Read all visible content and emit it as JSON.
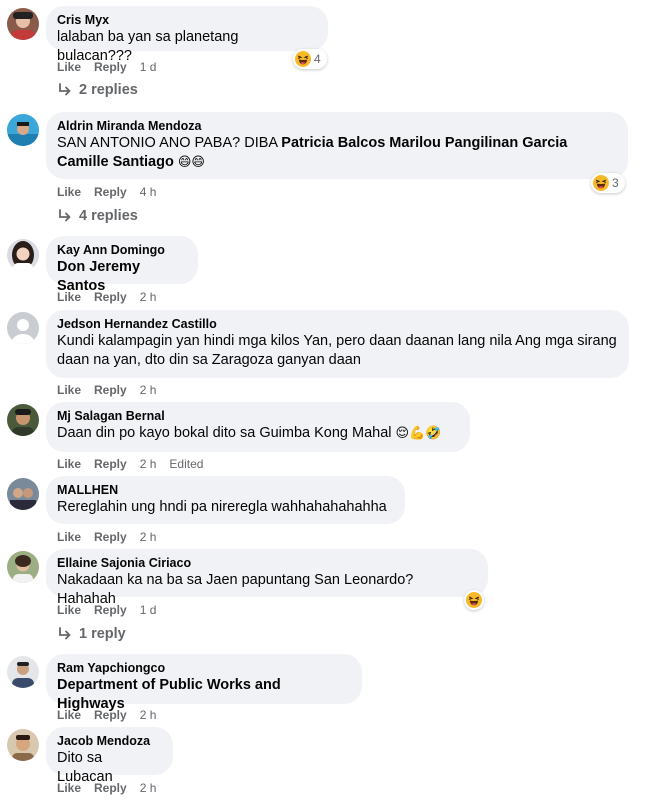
{
  "actions": {
    "like": "Like",
    "reply": "Reply"
  },
  "comments": [
    {
      "author": "Cris Myx",
      "text": "lalaban ba yan sa planetang bulacan???",
      "time": "1 d",
      "reactions": {
        "icon": "haha-emoji-icon",
        "count": "4"
      },
      "replies": "2 replies"
    },
    {
      "author": "Aldrin Miranda Mendoza",
      "text_plain": "SAN ANTONIO ANO PABA? DIBA ",
      "mentions": "Patricia Balcos Marilou Pangilinan Garcia Camille Santiago",
      "emoji": "😄😄",
      "time": "4 h",
      "reactions": {
        "icon": "haha-emoji-icon",
        "count": "3"
      },
      "replies": "4 replies"
    },
    {
      "author": "Kay Ann Domingo",
      "mention": "Don Jeremy Santos",
      "time": "2 h"
    },
    {
      "author": "Jedson Hernandez Castillo",
      "text": "Kundi kalampagin yan hindi mga kilos Yan, pero daan daanan lang nila Ang mga sirang daan na yan, dto din sa Zaragoza ganyan daan",
      "time": "2 h"
    },
    {
      "author": "Mj Salagan Bernal",
      "text": "Daan din po kayo bokal dito sa Guimba Kong Mahal ",
      "emoji": "😌💪🤣",
      "time": "2 h",
      "edited": "Edited"
    },
    {
      "author": "MALLHEN",
      "text": "Rereglahin ung hndi pa nireregla wahhahahahahha",
      "time": "2 h"
    },
    {
      "author": "Ellaine Sajonia Ciriaco",
      "text": "Nakadaan ka na ba sa Jaen papuntang San Leonardo? Hahahah",
      "time": "1 d",
      "reactions": {
        "icon": "haha-emoji-icon"
      },
      "replies": "1 reply"
    },
    {
      "author": "Ram Yapchiongco",
      "mention": "Department of Public Works and Highways",
      "time": "2 h"
    },
    {
      "author": "Jacob Mendoza",
      "text": "Dito sa Lubacan",
      "time": "2 h"
    }
  ],
  "colors": {
    "bubble": "#f0f2f5",
    "meta_gray": "#65676b",
    "text": "#050505",
    "haha_yellow": "#f7b928"
  }
}
